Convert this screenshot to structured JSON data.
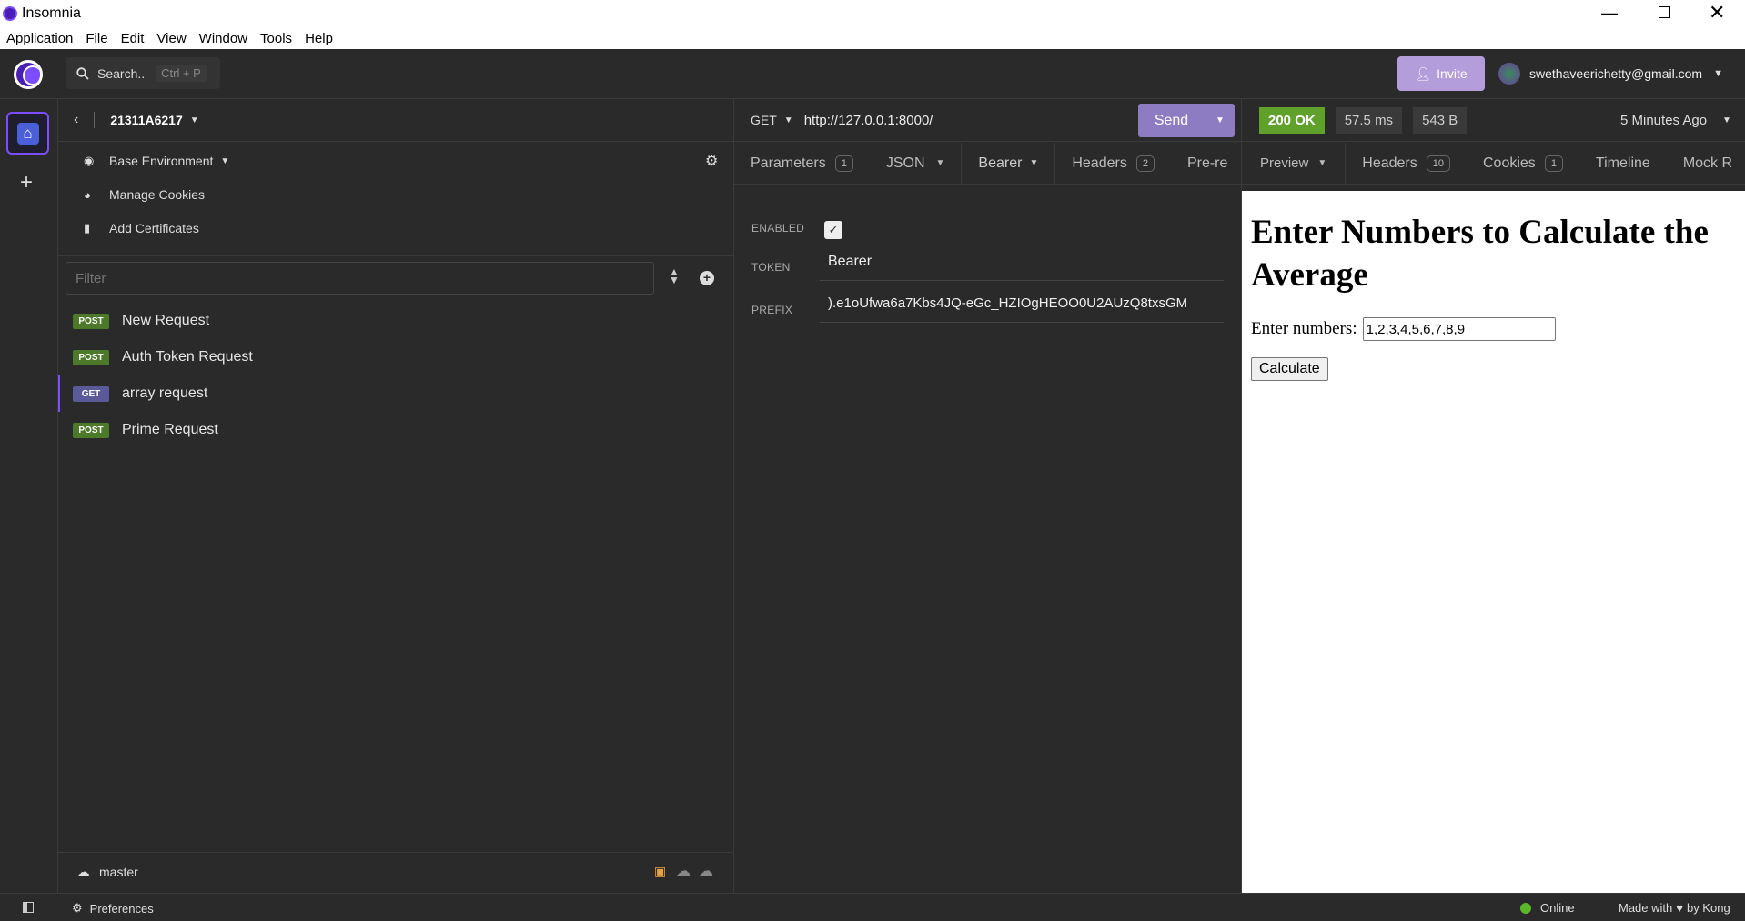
{
  "window": {
    "title": "Insomnia",
    "controls": [
      "minimize",
      "restore",
      "close"
    ]
  },
  "menu": [
    "Application",
    "File",
    "Edit",
    "View",
    "Window",
    "Tools",
    "Help"
  ],
  "topbar": {
    "search_label": "Search..",
    "search_shortcut": "Ctrl + P",
    "invite_label": "Invite",
    "user_email": "swethaveerichetty@gmail.com"
  },
  "project": {
    "name": "21311A6217"
  },
  "sidebar": {
    "environment": "Base Environment",
    "manage_cookies": "Manage Cookies",
    "add_certificates": "Add Certificates",
    "filter_placeholder": "Filter",
    "requests": [
      {
        "method": "POST",
        "name": "New Request"
      },
      {
        "method": "POST",
        "name": "Auth Token Request"
      },
      {
        "method": "GET",
        "name": "array request"
      },
      {
        "method": "POST",
        "name": "Prime Request"
      }
    ],
    "branch": "master"
  },
  "request": {
    "method": "GET",
    "url": "http://127.0.0.1:8000/",
    "send_label": "Send",
    "tabs": [
      {
        "label": "Parameters",
        "count": "1"
      },
      {
        "label": "JSON"
      },
      {
        "label": "Bearer"
      },
      {
        "label": "Headers",
        "count": "2"
      },
      {
        "label": "Pre-re"
      }
    ],
    "auth": {
      "enabled_label": "ENABLED",
      "token_label": "TOKEN",
      "token_value": "Bearer",
      "prefix_label": "PREFIX",
      "prefix_value": ").e1oUfwa6a7Kbs4JQ-eGc_HZIOgHEOO0U2AUzQ8txsGM"
    }
  },
  "response": {
    "status": "200 OK",
    "time": "57.5 ms",
    "size": "543 B",
    "age": "5 Minutes Ago",
    "tabs": [
      {
        "label": "Preview"
      },
      {
        "label": "Headers",
        "count": "10"
      },
      {
        "label": "Cookies",
        "count": "1"
      },
      {
        "label": "Timeline"
      },
      {
        "label": "Mock R"
      }
    ],
    "preview": {
      "heading": "Enter Numbers to Calculate the Average",
      "input_label": "Enter numbers:",
      "input_value": "1,2,3,4,5,6,7,8,9",
      "button_label": "Calculate"
    }
  },
  "statusbar": {
    "preferences": "Preferences",
    "online": "Online",
    "made_with_prefix": "Made with",
    "made_with_suffix": "by Kong"
  },
  "colors": {
    "accent": "#7c4dff",
    "invite_bg": "#b39ddb",
    "send_bg": "#8e7cc3",
    "status_ok": "#60a12b",
    "online": "#5cb82a"
  }
}
